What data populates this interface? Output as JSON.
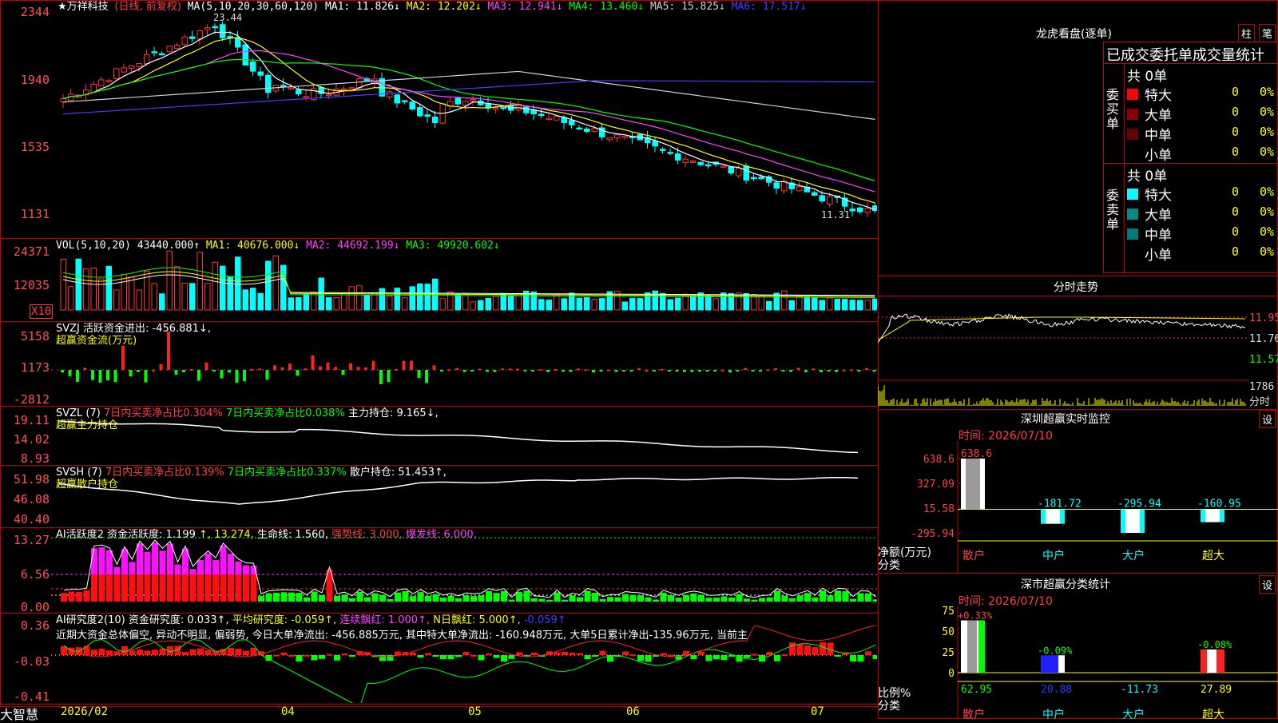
{
  "stock": {
    "name": "★万祥科技",
    "mode": "(日线, 前复权)",
    "ma_label": "MA(5,10,20,30,60,120)",
    "ma": [
      {
        "label": "MA1: 11.826↓",
        "color": "#ffffff"
      },
      {
        "label": "MA2: 12.202↓",
        "color": "#ffff00"
      },
      {
        "label": "MA3: 12.941↓",
        "color": "#ff40ff"
      },
      {
        "label": "MA4: 13.460↓",
        "color": "#00ff00"
      },
      {
        "label": "MA5: 15.825↓",
        "color": "#d0d0d0"
      },
      {
        "label": "MA6: 17.517↓",
        "color": "#4040ff"
      }
    ],
    "high_label": "23.44",
    "low_label": "11.31",
    "price_axis": [
      "2344",
      "1940",
      "1535",
      "1131"
    ]
  },
  "vol": {
    "header": "VOL(5,10,20)",
    "value": "43440.000↑",
    "ma": [
      {
        "label": "MA1: 40676.000↓",
        "color": "#ffffff"
      },
      {
        "label": "MA2: 44692.199↓",
        "color": "#ffff00"
      },
      {
        "label": "MA3: 49920.602↓",
        "color": "#00ff00"
      }
    ],
    "axis": [
      "24371",
      "12035"
    ],
    "unit": "X10"
  },
  "svzj": {
    "header": "SVZJ  活跃资金进出: -456.881↓,",
    "sub": "超赢资金流(万元)",
    "axis": [
      "5158",
      "1173",
      "-2812"
    ]
  },
  "svzl": {
    "header_a": "SVZL (7)",
    "header_b": "7日内买卖净占比0.304%",
    "header_c": "7日内买卖净占比0.038%",
    "header_d": "主力持仓: 9.165↓,",
    "sub": "超赢主力持仓",
    "axis": [
      "19.11",
      "14.02",
      "8.93"
    ]
  },
  "svsh": {
    "header_a": "SVSH (7)",
    "header_b": "7日内买卖净占比0.139%",
    "header_c": "7日内买卖净占比0.337%",
    "header_d": "散户持仓: 51.453↑,",
    "sub": "超赢散户持仓",
    "axis": [
      "51.98",
      "46.08",
      "40.40"
    ]
  },
  "ai1": {
    "header_a": "AI活跃度2",
    "header_b": "资金活跃度: 1.199",
    "header_c": "↑, 13.274,",
    "header_d": "生命线: 1.560,",
    "header_e": "强势线: 3.000,",
    "header_f": "爆发线: 6.000,",
    "axis": [
      "13.27",
      "6.56",
      "0.00"
    ]
  },
  "ai2": {
    "header_a": "AI研究度2(10)",
    "header_b": "资金研究度: 0.033↑,",
    "header_c": "平均研究度: -0.059↑,",
    "header_d": "连续飘红: 1.000↑,",
    "header_e": "N日飘红: 5.000↑,",
    "header_f": "-0.059↑",
    "comment": "近期大资金总体偏空, 异动不明显, 偏弱势, 今日大单净流出: -456.885万元, 其中特大单净流出: -160.948万元, 大单5日累计净出-135.96万元, 当前主",
    "axis": [
      "0.36",
      "-0.03",
      "-0.41"
    ]
  },
  "timeline": {
    "brand": "大智慧",
    "labels": [
      "2026/02",
      "04",
      "05",
      "06",
      "07"
    ]
  },
  "dragon": {
    "title": "龙虎看盘(逐单)",
    "btn_bar": "柱",
    "btn_pen": "笔",
    "table_title": "已成交委托单成交量统计",
    "buy_side": "委买单",
    "sell_side": "委卖单",
    "buy_total": "共 0单",
    "sell_total": "共 0单",
    "buy_rows": [
      {
        "label": "特大",
        "val": "0",
        "pct": "0%",
        "color": "#ff0000"
      },
      {
        "label": "大单",
        "val": "0",
        "pct": "0%",
        "color": "#8b0000"
      },
      {
        "label": "中单",
        "val": "0",
        "pct": "0%",
        "color": "#6b0000"
      },
      {
        "label": "小单",
        "val": "0",
        "pct": "0%",
        "color": "#000000"
      }
    ],
    "sell_rows": [
      {
        "label": "特大",
        "val": "0",
        "pct": "0%",
        "color": "#00ffff"
      },
      {
        "label": "大单",
        "val": "0",
        "pct": "0%",
        "color": "#008b8b"
      },
      {
        "label": "中单",
        "val": "0",
        "pct": "0%",
        "color": "#007a7a"
      },
      {
        "label": "小单",
        "val": "0",
        "pct": "0%",
        "color": "#000000"
      }
    ]
  },
  "intraday": {
    "title": "分时走势",
    "axis": [
      "11.95",
      "11.76",
      "11.57"
    ],
    "vol_label": "1786",
    "vol_unit": "分时"
  },
  "monitor": {
    "title": "深圳超赢实时监控",
    "btn": "设",
    "time": "时间: 2026/07/10",
    "axis": [
      "638.6",
      "327.09",
      "15.58",
      "-295.94"
    ],
    "ylabel": "净额(万元)",
    "xlabel": "分类",
    "bar_labels": [
      "638.6",
      "-181.72",
      "-295.94",
      "-160.95"
    ],
    "categories": [
      "散户",
      "中户",
      "大户",
      "超大"
    ]
  },
  "classify": {
    "title": "深市超赢分类统计",
    "btn": "设",
    "time": "时间: 2026/07/10",
    "axis": [
      "75",
      "50",
      "25",
      "0"
    ],
    "ylabel": "比例%",
    "xlabel": "分类",
    "top_labels": [
      "+0.33%",
      "-0.09%",
      "",
      "-0.08%"
    ],
    "bottom_labels": [
      "62.95",
      "20.88",
      "-11.73",
      "27.89"
    ],
    "categories": [
      "散户",
      "中户",
      "大户",
      "超大"
    ]
  },
  "chart_data": [
    {
      "type": "bar",
      "title": "深圳超赢实时监控",
      "ylabel": "净额(万元)",
      "xlabel": "分类",
      "categories": [
        "散户",
        "中户",
        "大户",
        "超大"
      ],
      "values": [
        638.6,
        -181.72,
        -295.94,
        -160.95
      ],
      "ylim": [
        -295.94,
        638.6
      ]
    },
    {
      "type": "bar",
      "title": "深市超赢分类统计",
      "ylabel": "比例%",
      "xlabel": "分类",
      "categories": [
        "散户",
        "中户",
        "大户",
        "超大"
      ],
      "values": [
        62.95,
        20.88,
        -11.73,
        27.89
      ],
      "ylim": [
        0,
        75
      ]
    },
    {
      "type": "line",
      "series": [
        {
          "name": "MA1",
          "values": [
            11.826
          ]
        },
        {
          "name": "MA2",
          "values": [
            12.202
          ]
        },
        {
          "name": "MA3",
          "values": [
            12.941
          ]
        },
        {
          "name": "MA4",
          "values": [
            13.46
          ]
        },
        {
          "name": "MA5",
          "values": [
            15.825
          ]
        },
        {
          "name": "MA6",
          "values": [
            17.517
          ]
        }
      ],
      "ylim": [
        11.31,
        23.44
      ]
    }
  ]
}
